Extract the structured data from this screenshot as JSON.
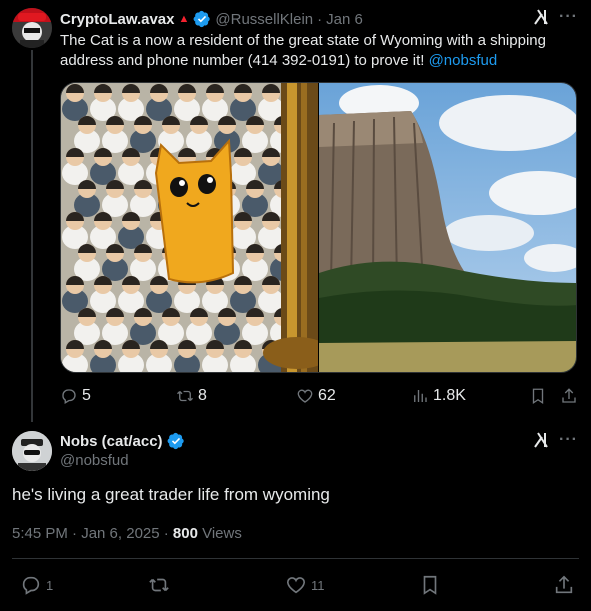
{
  "tweet1": {
    "display_name": "CryptoLaw.avax",
    "handle": "@RussellKlein",
    "date": "Jan 6",
    "text_before": "The Cat is a now a resident of the great state of Wyoming with a shipping address and phone number (414 392-0191) to prove it! ",
    "mention": "@nobsfud",
    "replies": "5",
    "reposts": "8",
    "likes": "62",
    "views": "1.8K"
  },
  "tweet2": {
    "display_name": "Nobs (cat/acc)",
    "handle": "@nobsfud",
    "text": "he's living a great trader life from wyoming",
    "time": "5:45 PM · Jan 6, 2025 · ",
    "views_count": "800",
    "views_label": " Views",
    "replies": "1",
    "likes": "11"
  },
  "colors": {
    "background": "#000000",
    "text": "#e7e9ea",
    "muted": "#71767b",
    "accent": "#1d9bf0",
    "verified": "#1d9bf0",
    "border": "#2f3336"
  },
  "icons": [
    "verified-badge-icon",
    "grok-icon",
    "more-icon",
    "reply-icon",
    "repost-icon",
    "like-icon",
    "views-icon",
    "bookmark-icon",
    "share-icon"
  ]
}
